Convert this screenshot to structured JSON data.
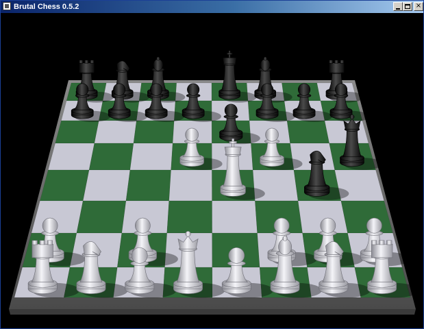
{
  "window": {
    "title": "Brutal Chess 0.5.2",
    "minimize_label": "",
    "maximize_label": "",
    "close_label": "×"
  },
  "colors": {
    "dark_square": "#2f6b38",
    "light_square": "#c8c8d4",
    "board_edge": "#6c6c6c",
    "background": "#000000",
    "white_piece": "#e6e6ea",
    "black_piece": "#1e1e1e"
  },
  "board": {
    "pieces": [
      {
        "color": "black",
        "type": "rook",
        "square": "a8"
      },
      {
        "color": "black",
        "type": "knight",
        "square": "b8"
      },
      {
        "color": "black",
        "type": "bishop",
        "square": "c8"
      },
      {
        "color": "black",
        "type": "king",
        "square": "e8"
      },
      {
        "color": "black",
        "type": "bishop",
        "square": "f8"
      },
      {
        "color": "black",
        "type": "rook",
        "square": "h8"
      },
      {
        "color": "black",
        "type": "pawn",
        "square": "a7"
      },
      {
        "color": "black",
        "type": "pawn",
        "square": "b7"
      },
      {
        "color": "black",
        "type": "pawn",
        "square": "c7"
      },
      {
        "color": "black",
        "type": "pawn",
        "square": "d7"
      },
      {
        "color": "black",
        "type": "pawn",
        "square": "f7"
      },
      {
        "color": "black",
        "type": "pawn",
        "square": "g7"
      },
      {
        "color": "black",
        "type": "pawn",
        "square": "h7"
      },
      {
        "color": "black",
        "type": "pawn",
        "square": "e6"
      },
      {
        "color": "black",
        "type": "queen",
        "square": "h5"
      },
      {
        "color": "black",
        "type": "knight",
        "square": "g4"
      },
      {
        "color": "white",
        "type": "pawn",
        "square": "d5"
      },
      {
        "color": "white",
        "type": "pawn",
        "square": "f5"
      },
      {
        "color": "white",
        "type": "king",
        "square": "e4"
      },
      {
        "color": "white",
        "type": "pawn",
        "square": "a2"
      },
      {
        "color": "white",
        "type": "pawn",
        "square": "c2"
      },
      {
        "color": "white",
        "type": "pawn",
        "square": "f2"
      },
      {
        "color": "white",
        "type": "pawn",
        "square": "g2"
      },
      {
        "color": "white",
        "type": "pawn",
        "square": "h2"
      },
      {
        "color": "white",
        "type": "rook",
        "square": "a1"
      },
      {
        "color": "white",
        "type": "knight",
        "square": "b1"
      },
      {
        "color": "white",
        "type": "pawn",
        "square": "c1"
      },
      {
        "color": "white",
        "type": "queen",
        "square": "d1"
      },
      {
        "color": "white",
        "type": "pawn",
        "square": "e1"
      },
      {
        "color": "white",
        "type": "bishop",
        "square": "f1"
      },
      {
        "color": "white",
        "type": "knight",
        "square": "g1"
      },
      {
        "color": "white",
        "type": "rook",
        "square": "h1"
      }
    ]
  }
}
